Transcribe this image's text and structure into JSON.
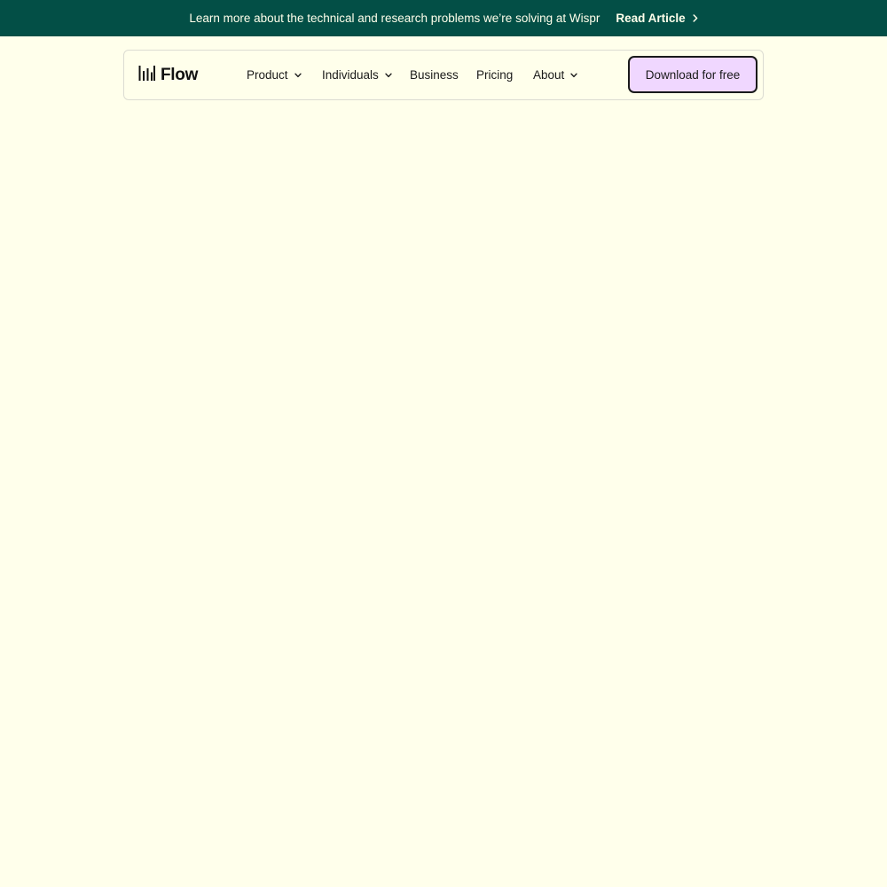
{
  "announcement": {
    "text": "Learn more about the technical and research problems we’re solving at Wispr",
    "link_label": "Read Article",
    "link_icon": "chevron-right-icon",
    "background": "#034F46",
    "text_color": "#FFFFEB"
  },
  "header": {
    "logo_icon": "waveform-bars-icon",
    "logo_text": "Flow",
    "nav": [
      {
        "label": "Product",
        "has_dropdown": true
      },
      {
        "label": "Individuals",
        "has_dropdown": true
      },
      {
        "label": "Business",
        "has_dropdown": false
      },
      {
        "label": "Pricing",
        "has_dropdown": false
      },
      {
        "label": "About",
        "has_dropdown": true
      }
    ],
    "cta_label": "Download for free",
    "cta_color": "#F0D7FF"
  },
  "page": {
    "background": "#FFFFEB"
  }
}
